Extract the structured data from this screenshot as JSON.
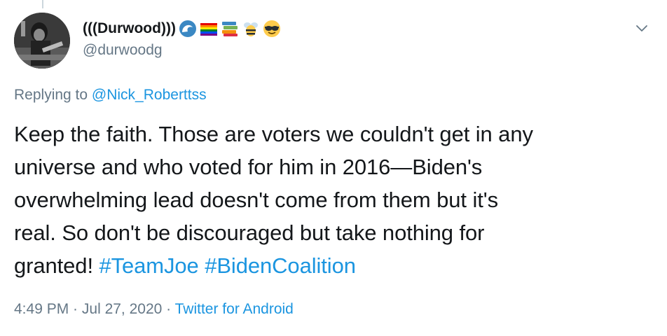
{
  "tweet": {
    "display_name": "(((Durwood)))",
    "emojis": [
      "wave-emoji",
      "rainbow-flag-emoji",
      "books-emoji",
      "bee-emoji",
      "sunglasses-emoji"
    ],
    "handle": "@durwoodg",
    "replying_prefix": "Replying to ",
    "replying_to": "@Nick_Roberttss",
    "text_line1": "Keep the faith. Those are voters we couldn't get in any",
    "text_line2": "universe and who voted for him in 2016—Biden's",
    "text_line3": "overwhelming lead doesn't come from them but it's",
    "text_line4": "real. So don't be discouraged but take nothing for",
    "text_line5": "granted! ",
    "hashtag1": "#TeamJoe",
    "hashtag2": "#BidenCoalition",
    "time": "4:49 PM",
    "separator": " · ",
    "date": "Jul 27, 2020",
    "source": "Twitter for Android",
    "link_color": "#1b95e0",
    "secondary_color": "#657786"
  }
}
